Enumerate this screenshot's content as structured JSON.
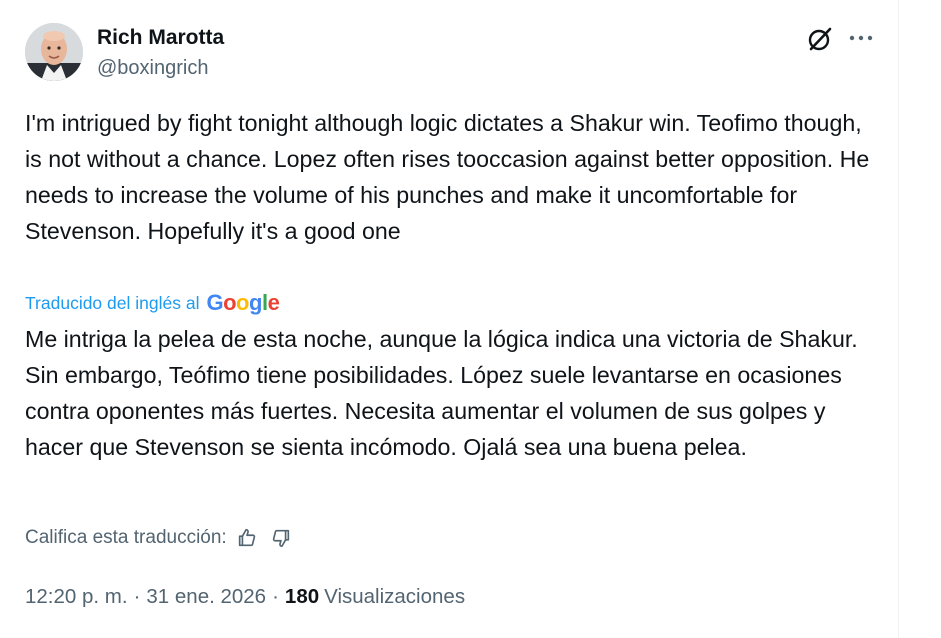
{
  "author": {
    "name": "Rich Marotta",
    "handle": "@boxingrich"
  },
  "post": {
    "original_text": "I'm intrigued by fight tonight although logic dictates a Shakur win. Teofimo though, is not without a chance. Lopez often rises tooccasion against better opposition. He needs to increase the volume of his punches and make it uncomfortable for Stevenson. Hopefully it's a good one",
    "translated_from_label": "Traducido del inglés al",
    "translation_provider": "Google",
    "translated_text": "Me intriga la pelea de esta noche, aunque la lógica indica una victoria de Shakur. Sin embargo, Teófimo tiene posibilidades. López suele levantarse en ocasiones contra oponentes más fuertes. Necesita aumentar el volumen de sus golpes y hacer que Stevenson se sienta incómodo. Ojalá sea una buena pelea.",
    "rate_translation_label": "Califica esta traducción:",
    "time": "12:20 p. m.",
    "date": "31 ene. 2026",
    "separator": "·",
    "views_count": "180",
    "views_label": "Visualizaciones"
  },
  "icons": {
    "grok": "grok-icon",
    "more": "more-icon",
    "thumbs_up": "thumbs-up-icon",
    "thumbs_down": "thumbs-down-icon"
  },
  "colors": {
    "text_primary": "#0f1419",
    "text_secondary": "#536471",
    "link_blue": "#1d9bf0"
  }
}
